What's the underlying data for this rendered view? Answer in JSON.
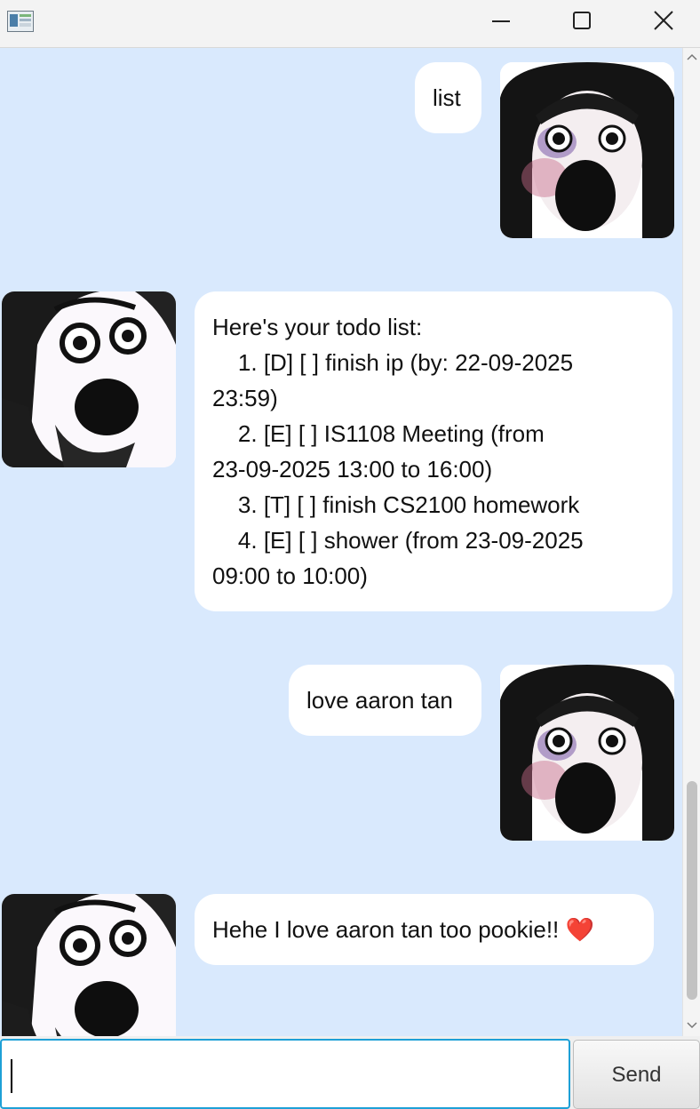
{
  "window": {
    "controls": [
      "minimize-icon",
      "maximize-icon",
      "close-icon"
    ]
  },
  "messages": [
    {
      "sender": "user",
      "text": "list"
    },
    {
      "sender": "bot",
      "text": "Here's your todo list:\n    1. [D] [ ] finish ip (by: 22-09-2025\n23:59)\n    2. [E] [ ] IS1108 Meeting (from\n23-09-2025 13:00 to 16:00)\n    3. [T] [ ] finish CS2100 homework\n    4. [E] [ ] shower (from 23-09-2025\n09:00 to 10:00)"
    },
    {
      "sender": "user",
      "text": "love aaron tan"
    },
    {
      "sender": "bot",
      "text": "Hehe I love aaron tan too pookie!! ❤️"
    }
  ],
  "input": {
    "value": "",
    "placeholder": ""
  },
  "send_button": {
    "label": "Send"
  },
  "colors": {
    "chat_background": "#d9e9fd",
    "bubble": "#ffffff",
    "input_focus": "#1ea0d6"
  }
}
